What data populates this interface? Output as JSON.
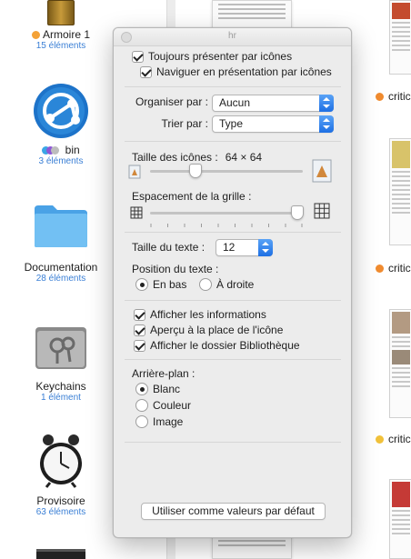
{
  "finder": {
    "items": [
      {
        "name": "Armoire 1",
        "count": "15 éléments",
        "tag": "#f4a237"
      },
      {
        "name": "bin",
        "count": "3 éléments",
        "tags": [
          "#3aa6e6",
          "#8e57d6",
          "#bdbdbd"
        ]
      },
      {
        "name": "Documentation",
        "count": "28 éléments"
      },
      {
        "name": "Keychains",
        "count": "1 élément"
      },
      {
        "name": "Provisoire",
        "count": "63 éléments"
      }
    ],
    "right_labels": [
      {
        "text": "critic",
        "tag": "#f08b2f"
      },
      {
        "text": "critic",
        "tag": "#f08b2f"
      },
      {
        "text": "critic",
        "tag": "#f1c13a"
      }
    ]
  },
  "panel": {
    "title": "hr",
    "always_icons": "Toujours présenter par icônes",
    "browse_icons": "Naviguer en présentation par icônes",
    "arrange_label": "Organiser par :",
    "arrange_value": "Aucun",
    "sort_label": "Trier par :",
    "sort_value": "Type",
    "icon_size_label": "Taille des icônes :",
    "icon_size_value": "64 × 64",
    "icon_size_level": 0.3,
    "grid_spacing_label": "Espacement de la grille :",
    "grid_spacing_level": 1.0,
    "text_size_label": "Taille du texte :",
    "text_size_value": "12",
    "text_position_label": "Position du texte :",
    "position_bottom": "En bas",
    "position_right": "À droite",
    "show_info": "Afficher les informations",
    "icon_preview": "Aperçu à la place de l'icône",
    "show_library": "Afficher le dossier Bibliothèque",
    "background_label": "Arrière-plan :",
    "bg_white": "Blanc",
    "bg_color": "Couleur",
    "bg_image": "Image",
    "default_button": "Utiliser comme valeurs par défaut"
  },
  "colors": {
    "accent": "#1d6fe4",
    "folder_blue": "#6cb8f0",
    "count_blue": "#3a7fd5"
  }
}
